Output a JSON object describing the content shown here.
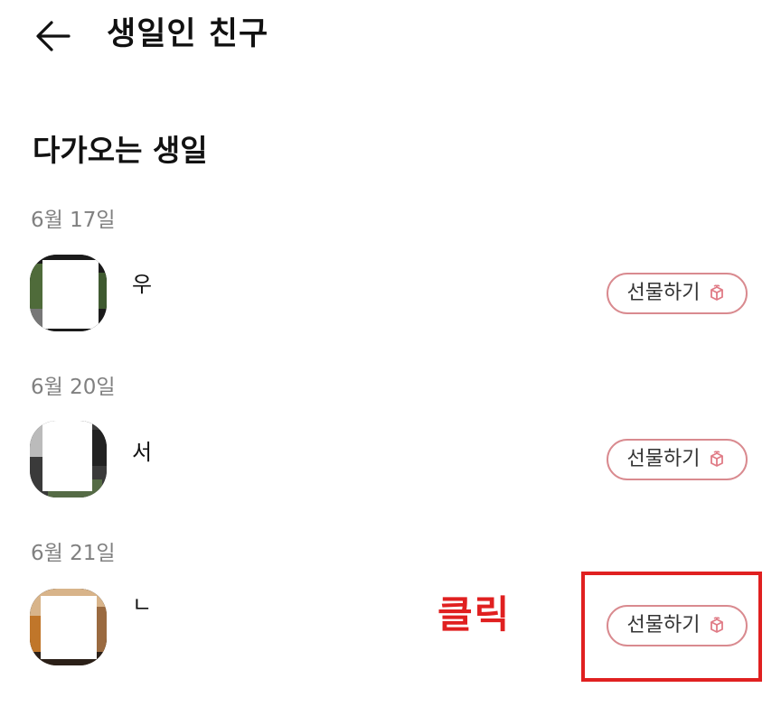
{
  "header": {
    "back_icon": "arrow-left-icon",
    "title": "생일인 친구"
  },
  "section": {
    "title": "다가오는 생일"
  },
  "groups": [
    {
      "date": "6월 17일",
      "friend": {
        "name": "우",
        "avatar_icon": "avatar-photo"
      },
      "gift_label": "선물하기",
      "gift_icon": "gift-box-icon"
    },
    {
      "date": "6월 20일",
      "friend": {
        "name": "서",
        "avatar_icon": "avatar-photo"
      },
      "gift_label": "선물하기",
      "gift_icon": "gift-box-icon"
    },
    {
      "date": "6월 21일",
      "friend": {
        "name": "ㄴ",
        "avatar_icon": "avatar-photo"
      },
      "gift_label": "선물하기",
      "gift_icon": "gift-box-icon"
    }
  ],
  "annotation": {
    "text": "클릭",
    "color": "#e02020"
  },
  "colors": {
    "gift_border": "#d98a8f",
    "gift_icon": "#e07b86",
    "date_text": "#808080"
  }
}
